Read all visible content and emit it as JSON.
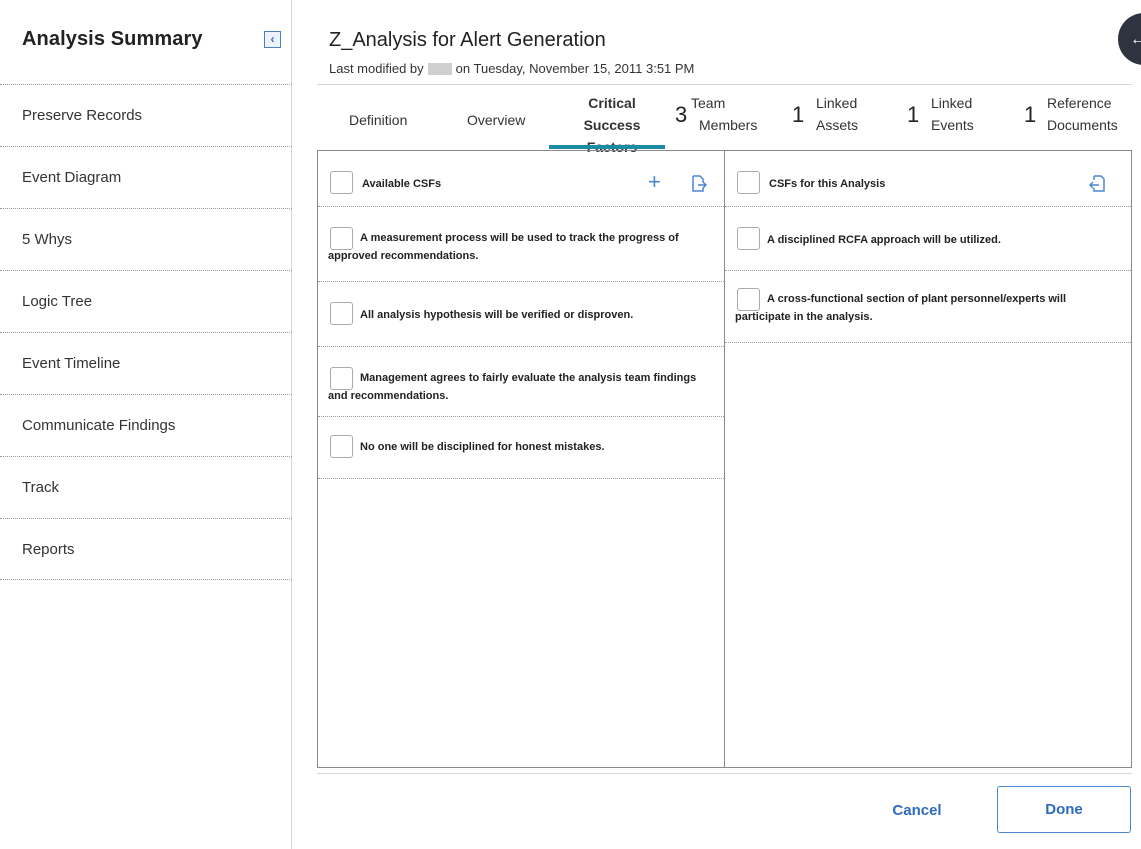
{
  "sidebar": {
    "title": "Analysis Summary",
    "collapse_icon": "chevron-left-icon",
    "items": [
      {
        "label": "Preserve Records"
      },
      {
        "label": "Event Diagram"
      },
      {
        "label": "5 Whys"
      },
      {
        "label": "Logic Tree"
      },
      {
        "label": "Event Timeline"
      },
      {
        "label": "Communicate Findings"
      },
      {
        "label": "Track"
      },
      {
        "label": "Reports"
      }
    ]
  },
  "header": {
    "title": "Z_Analysis for Alert Generation",
    "modified_prefix": "Last modified by",
    "modified_suffix": "on Tuesday, November 15, 2011 3:51 PM"
  },
  "tabs": {
    "definition": "Definition",
    "overview": "Overview",
    "csf": {
      "line1": "Critical",
      "line2": "Success",
      "line3": "Factors"
    },
    "team": {
      "count": "3",
      "line1": "Team",
      "line2": "Members"
    },
    "assets": {
      "count": "1",
      "line1": "Linked",
      "line2": "Assets"
    },
    "events": {
      "count": "1",
      "line1": "Linked",
      "line2": "Events"
    },
    "docs": {
      "count": "1",
      "line1": "Reference",
      "line2": "Documents"
    }
  },
  "available": {
    "header": "Available CSFs",
    "items": [
      "A measurement process will be used to track the progress of approved recommendations.",
      "All analysis hypothesis will be verified or disproven.",
      "Management agrees to fairly evaluate the analysis team findings and recommendations.",
      "No one will be disciplined for honest mistakes."
    ]
  },
  "selected": {
    "header": "CSFs for this Analysis",
    "items": [
      "A disciplined RCFA approach will be utilized.",
      "A cross-functional section of plant personnel/experts will participate in the analysis."
    ]
  },
  "footer": {
    "cancel": "Cancel",
    "done": "Done"
  },
  "colors": {
    "accent": "#1b8ba6",
    "link": "#2e6bc0",
    "fab": "#2d3440"
  }
}
